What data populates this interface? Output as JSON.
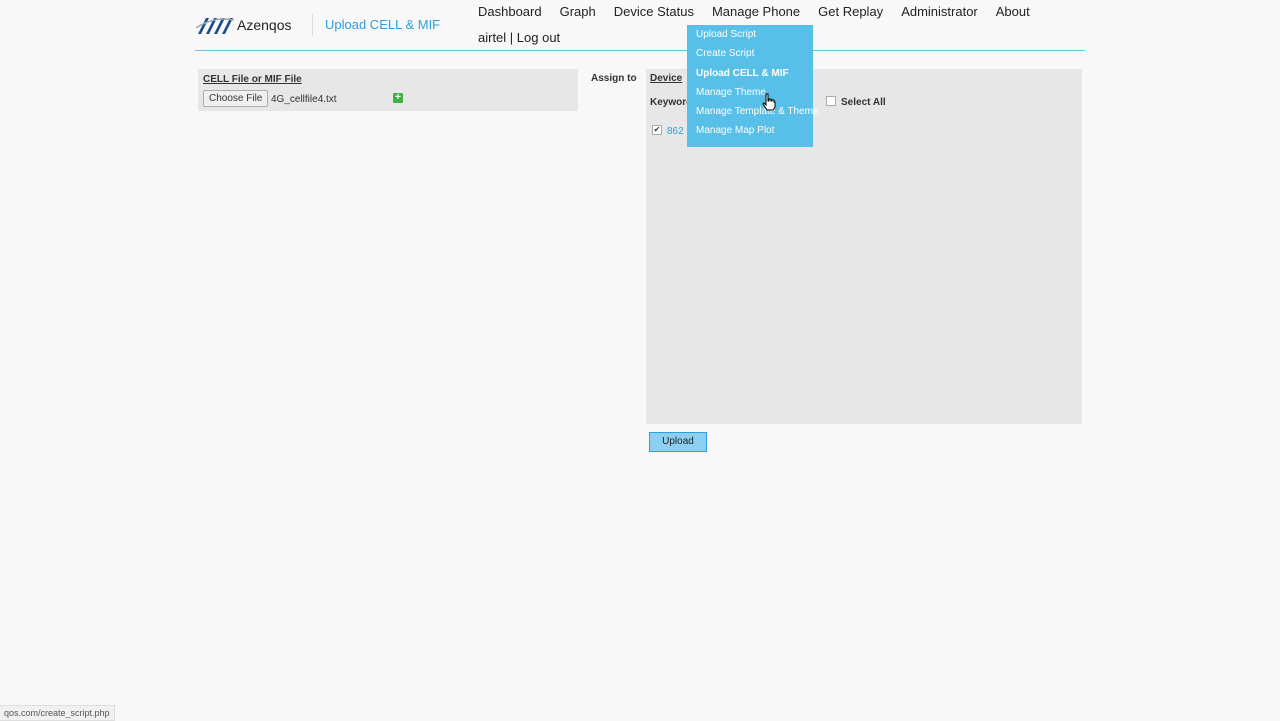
{
  "app": {
    "logo_text": "Azenqos",
    "page_title": "Upload CELL & MIF"
  },
  "nav": [
    {
      "label": "Dashboard"
    },
    {
      "label": "Graph"
    },
    {
      "label": "Device Status"
    },
    {
      "label": "Manage Phone"
    },
    {
      "label": "Get Replay"
    },
    {
      "label": "Administrator"
    },
    {
      "label": "About"
    }
  ],
  "user": {
    "name": "airtel",
    "separator": " | ",
    "logout": "Log out"
  },
  "dropdown": {
    "items": [
      {
        "label": "Upload Script"
      },
      {
        "label": "Create Script"
      },
      {
        "label": "Upload CELL & MIF"
      },
      {
        "label": "Manage Theme"
      },
      {
        "label": "Manage Template & Theme"
      },
      {
        "label": "Manage Map Plot"
      }
    ]
  },
  "cell_panel": {
    "title": "CELL File or MIF File",
    "choose_button": "Choose File",
    "file_name": "4G_cellfile4.txt"
  },
  "assign": {
    "label": "Assign to"
  },
  "device_panel": {
    "tab": "Device",
    "keyword_label": "Keyword",
    "select_all": "Select All",
    "device_item": "862",
    "checked_mark": "✔"
  },
  "upload_button": "Upload",
  "status_bar": "qos.com/create_script.php",
  "colors": {
    "accent": "#2e9fd8",
    "dropdown_bg": "#58bfe8",
    "add_green": "#3db33d"
  }
}
